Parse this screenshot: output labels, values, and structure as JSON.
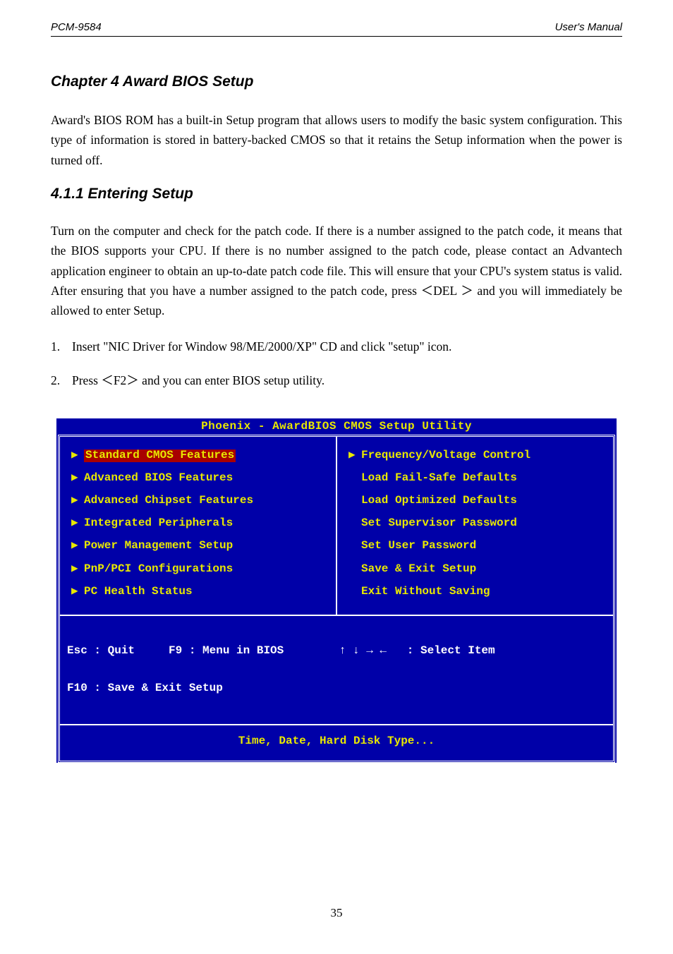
{
  "header": {
    "left": "PCM-9584",
    "right": "User's Manual"
  },
  "heading": "Chapter 4 Award BIOS Setup",
  "intro": "Award's BIOS ROM has a built-in Setup program that allows users to modify the basic system configuration. This type of information is stored in battery-backed CMOS so that it retains the Setup information when the power is turned off.",
  "section_heading": "4.1.1 Entering Setup",
  "section_body": "Turn on the computer and check for the patch code. If there is a number assigned to the patch code, it means that the BIOS supports your CPU. If there is no number assigned to the patch code, please contact an Advantech application engineer to obtain an up-to-date patch code file. This will ensure that your CPU's system status is valid. After ensuring that you have a number assigned to the patch code, press ＜DEL ＞ and you will immediately be allowed to enter Setup.",
  "instructions": {
    "item1": {
      "num": "1.",
      "text": "Insert \"NIC Driver for Window 98/ME/2000/XP\" CD and click \"setup\" icon."
    },
    "item2": {
      "num": "2.",
      "text": "Press ＜F2＞ and you can enter BIOS setup utility."
    }
  },
  "bios": {
    "title": "Phoenix - AwardBIOS CMOS Setup Utility",
    "left": [
      {
        "arrow": true,
        "label": "Standard CMOS Features",
        "selected": true
      },
      {
        "arrow": true,
        "label": "Advanced BIOS Features"
      },
      {
        "arrow": true,
        "label": "Advanced Chipset Features"
      },
      {
        "arrow": true,
        "label": "Integrated Peripherals"
      },
      {
        "arrow": true,
        "label": "Power Management Setup"
      },
      {
        "arrow": true,
        "label": "PnP/PCI Configurations"
      },
      {
        "arrow": true,
        "label": "PC Health Status"
      }
    ],
    "right": [
      {
        "arrow": true,
        "label": "Frequency/Voltage Control"
      },
      {
        "arrow": false,
        "label": "Load Fail-Safe Defaults"
      },
      {
        "arrow": false,
        "label": "Load Optimized Defaults"
      },
      {
        "arrow": false,
        "label": "Set Supervisor Password"
      },
      {
        "arrow": false,
        "label": "Set User Password"
      },
      {
        "arrow": false,
        "label": "Save & Exit Setup"
      },
      {
        "arrow": false,
        "label": "Exit Without Saving"
      }
    ],
    "keys": {
      "left_line1": "Esc : Quit     F9 : Menu in BIOS",
      "left_line2": "F10 : Save & Exit Setup",
      "right_line1": "↑ ↓ → ←   : Select Item"
    },
    "help": "Time, Date, Hard Disk Type..."
  },
  "footer": "35"
}
